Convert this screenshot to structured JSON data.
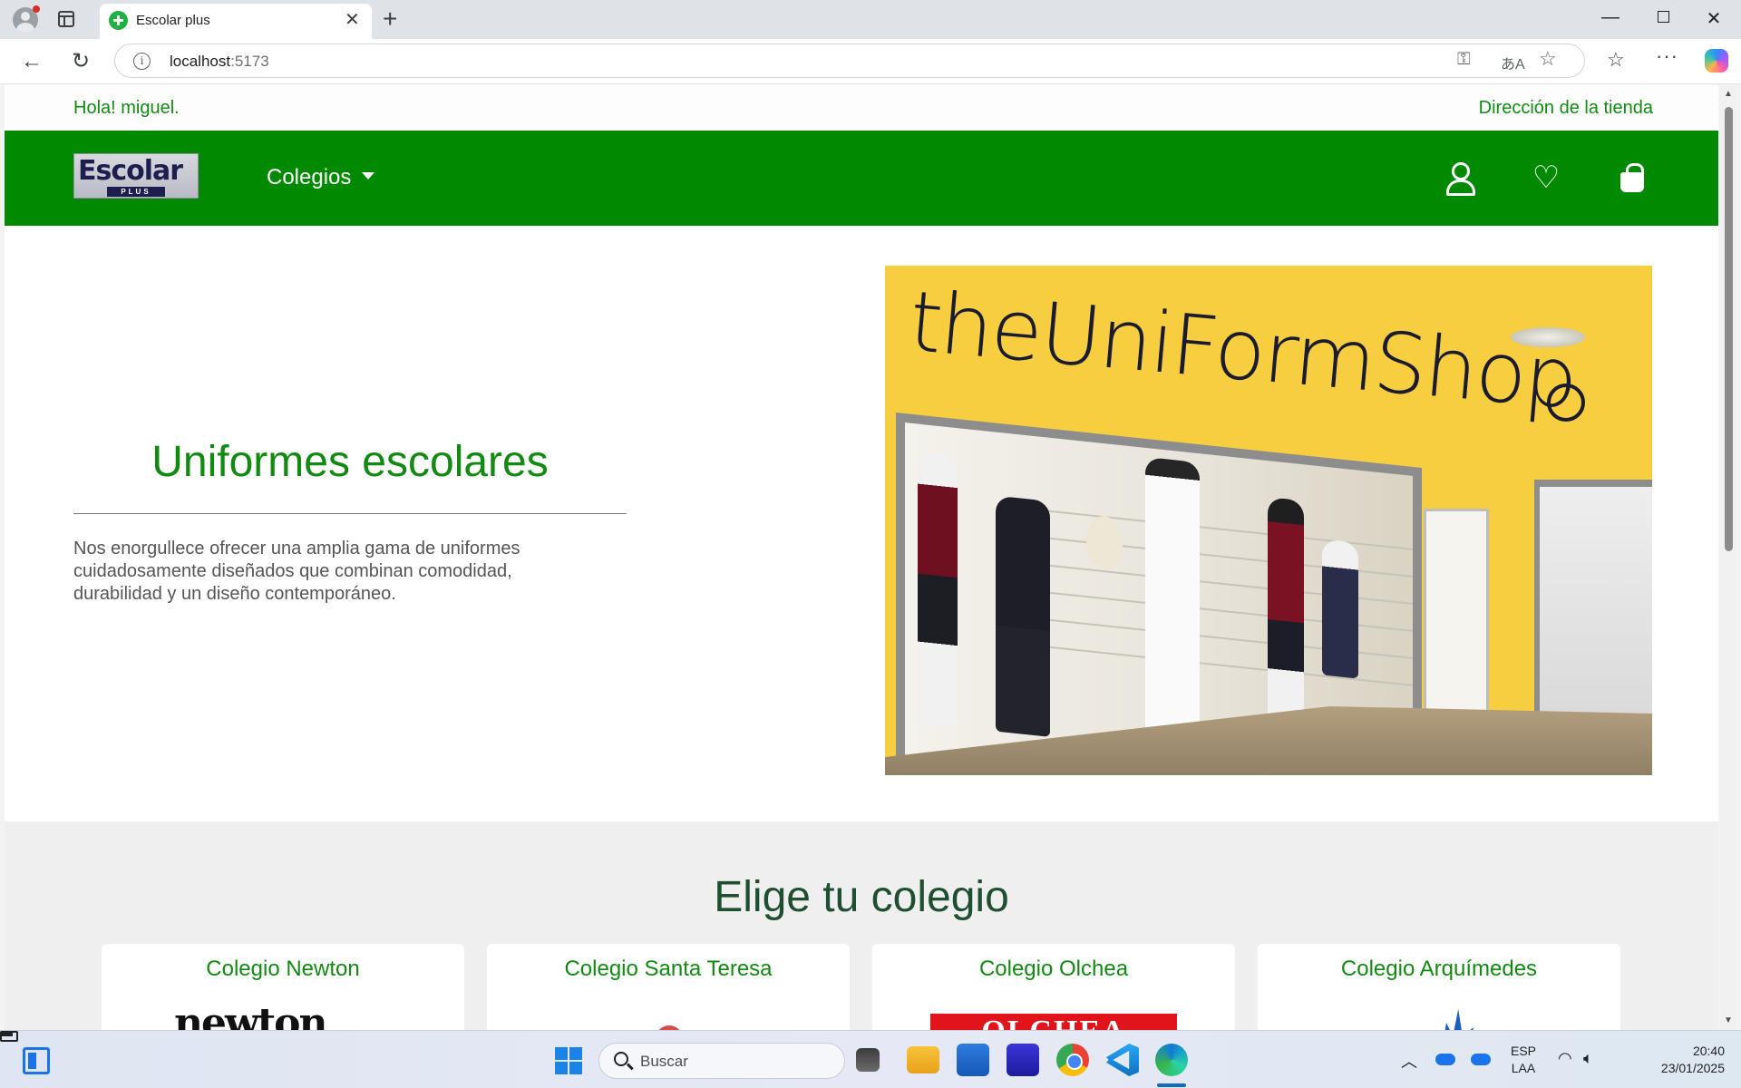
{
  "browser": {
    "tab_title": "Escolar plus",
    "tab_close": "✕",
    "new_tab": "+",
    "url_host": "localhost",
    "url_port": ":5173",
    "window_controls": {
      "minimize": "—",
      "close": "✕"
    },
    "icons": [
      "profile-icon",
      "tab-actions-icon",
      "back-icon",
      "reload-icon",
      "info-icon",
      "key-icon",
      "translate-icon",
      "star-icon",
      "favorites-icon",
      "more-icon",
      "copilot-icon"
    ]
  },
  "site": {
    "greeting": "Hola! miguel.",
    "store_link": "Dirección de la tienda",
    "logo_main": "Escolar",
    "logo_sub": "PLUS",
    "nav_menu": "Colegios",
    "colors": {
      "brand_green": "#018a01",
      "text_green": "#128a12",
      "section_title": "#1e4f30"
    }
  },
  "hero": {
    "title": "Uniformes escolares",
    "text": "Nos enorgullece ofrecer una amplia gama de uniformes cuidadosamente diseñados que combinan comodidad, durabilidad y un diseño contemporáneo.",
    "image_sign": "theUniFormShop"
  },
  "schools": {
    "title": "Elige tu colegio",
    "cards": [
      {
        "name": "Colegio Newton",
        "logo_text": "newton"
      },
      {
        "name": "Colegio Santa Teresa"
      },
      {
        "name": "Colegio Olchea",
        "logo_text": "OLCHEA"
      },
      {
        "name": "Colegio Arquímedes"
      }
    ]
  },
  "taskbar": {
    "search_placeholder": "Buscar",
    "lang_top": "ESP",
    "lang_bottom": "LAA",
    "time": "20:40",
    "date": "23/01/2025"
  }
}
